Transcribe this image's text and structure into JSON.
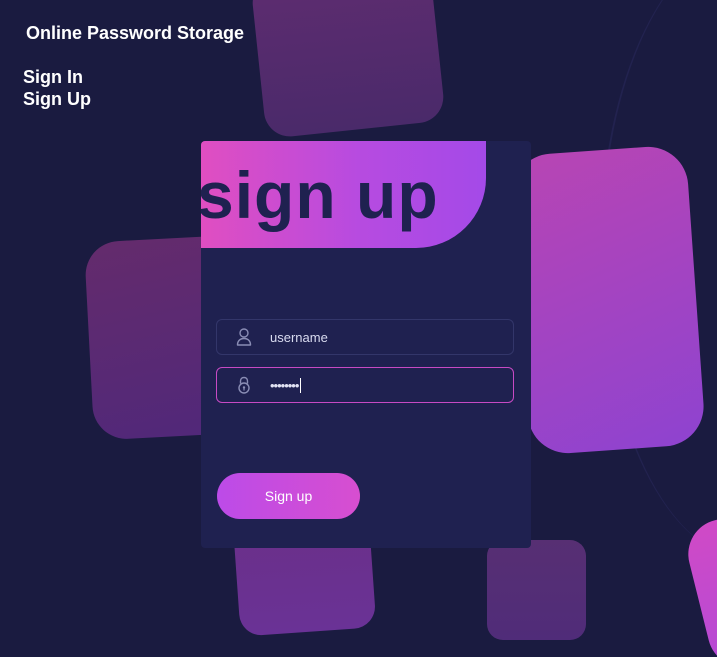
{
  "header": {
    "app_title": "Online Password Storage"
  },
  "nav": {
    "items": [
      {
        "label": "Sign In"
      },
      {
        "label": "Sign Up"
      }
    ]
  },
  "form": {
    "heading": "sign up",
    "username": {
      "placeholder": "username",
      "value": "",
      "icon": "user-icon"
    },
    "password": {
      "value": "••••••••",
      "icon": "lock-icon",
      "focused": true
    },
    "submit_label": "Sign up"
  },
  "colors": {
    "background": "#1a1b40",
    "card": "#1f2150",
    "accent_pink": "#e04ec1",
    "accent_purple": "#b74be0",
    "focus_border": "#c74ac4"
  }
}
